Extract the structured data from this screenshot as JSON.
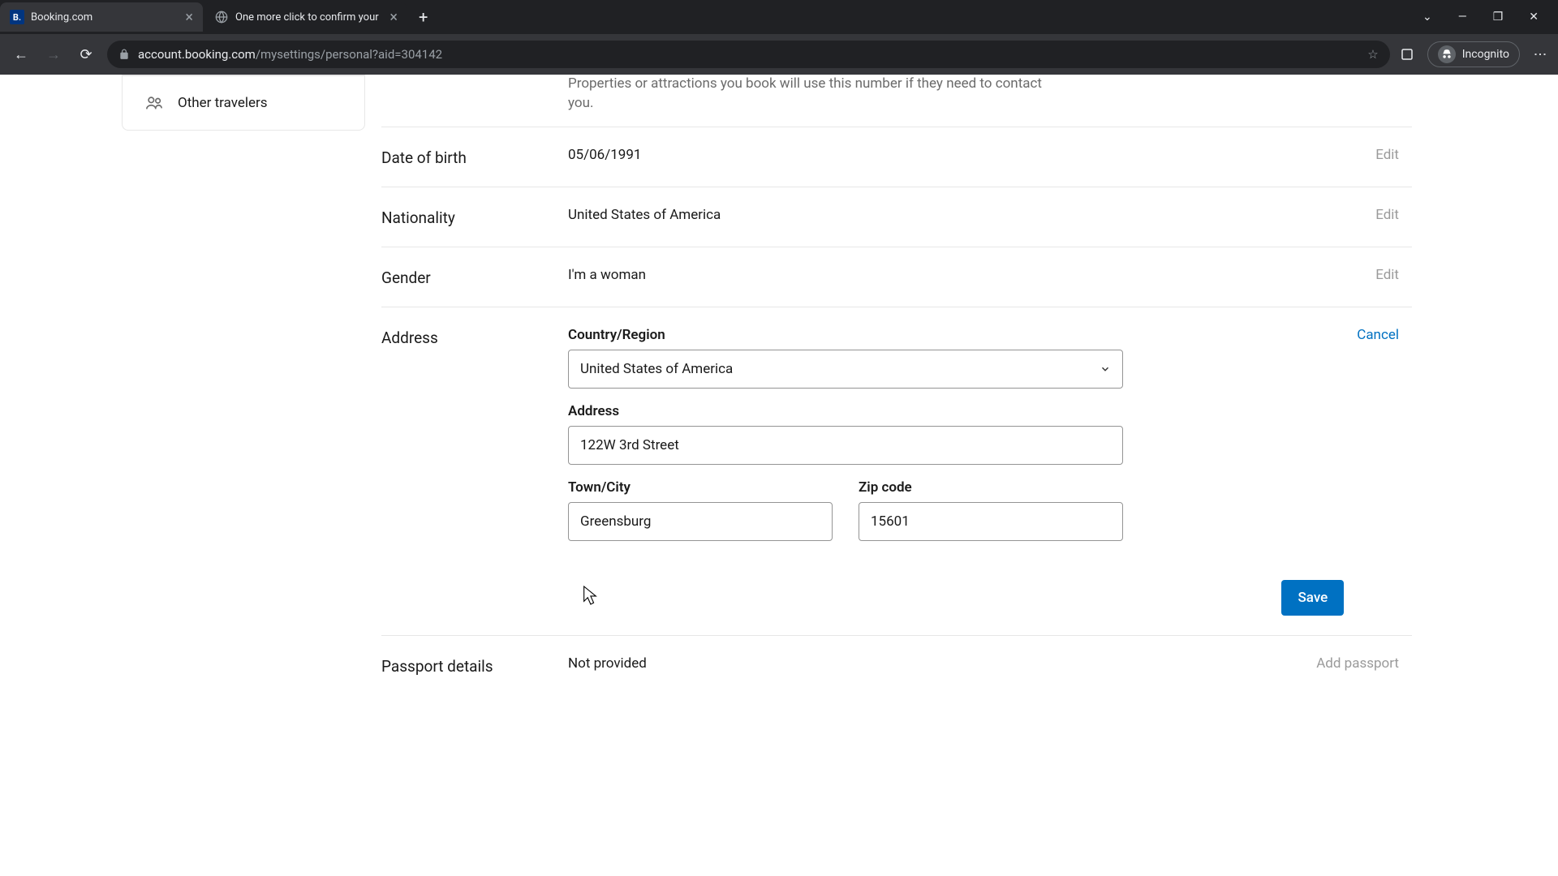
{
  "browser": {
    "tabs": [
      {
        "title": "Booking.com",
        "favicon": "B."
      },
      {
        "title": "One more click to confirm your"
      }
    ],
    "url_host": "account.booking.com",
    "url_path": "/mysettings/personal?aid=304142",
    "incognito_label": "Incognito"
  },
  "sidebar": {
    "other_travelers": "Other travelers"
  },
  "phone_hint": "Properties or attractions you book will use this number if they need to contact you.",
  "fields": {
    "dob": {
      "label": "Date of birth",
      "value": "05/06/1991",
      "action": "Edit"
    },
    "nationality": {
      "label": "Nationality",
      "value": "United States of America",
      "action": "Edit"
    },
    "gender": {
      "label": "Gender",
      "value": "I'm a woman",
      "action": "Edit"
    },
    "address": {
      "label": "Address",
      "cancel": "Cancel",
      "country_label": "Country/Region",
      "country_value": "United States of America",
      "address_label": "Address",
      "address_value": "122W 3rd Street",
      "city_label": "Town/City",
      "city_value": "Greensburg",
      "zip_label": "Zip code",
      "zip_value": "15601",
      "save": "Save"
    },
    "passport": {
      "label": "Passport details",
      "value": "Not provided",
      "action": "Add passport"
    }
  }
}
